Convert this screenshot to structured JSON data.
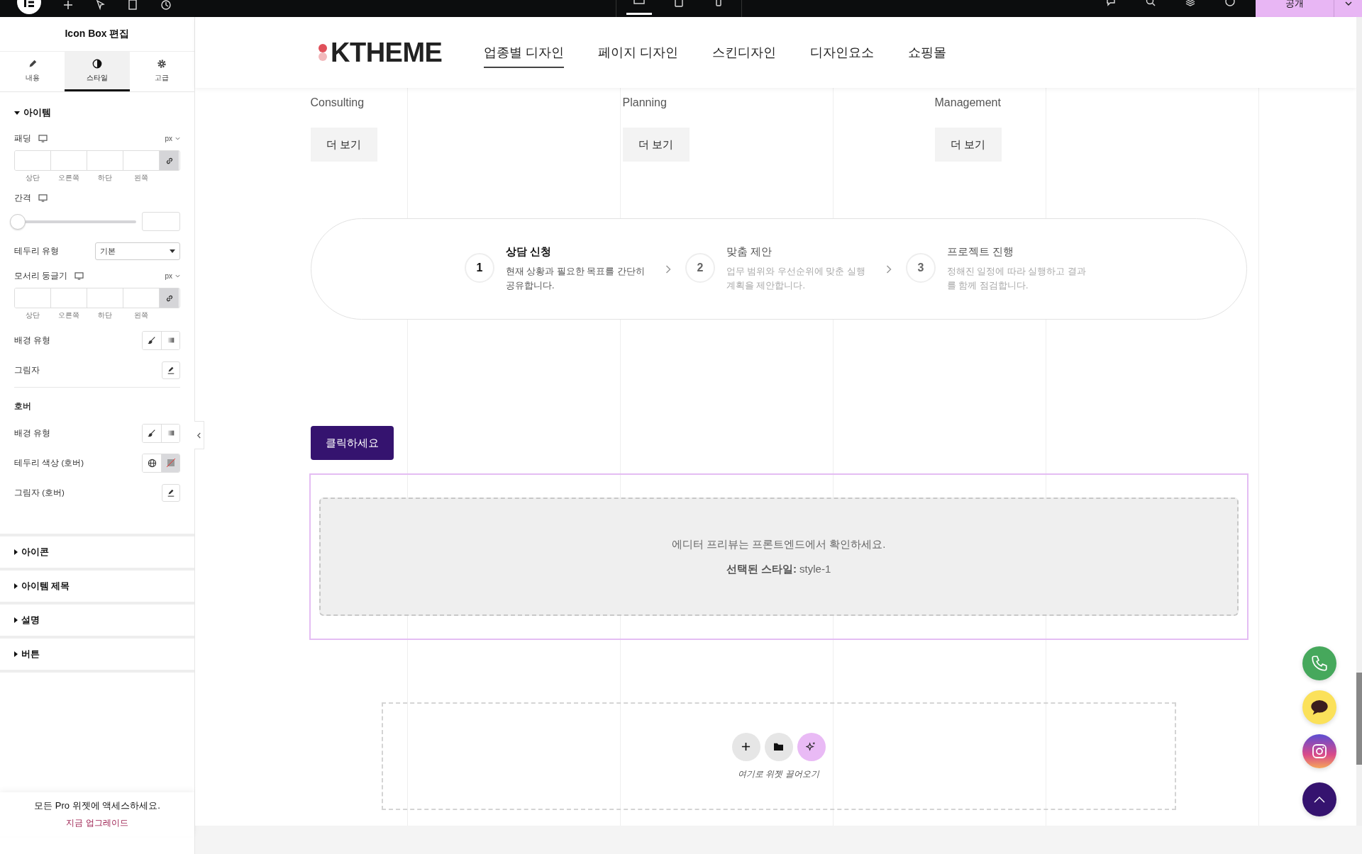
{
  "topbar": {
    "publish_label": "공개",
    "device_tabs": [
      {
        "selected": true
      },
      {
        "selected": false
      },
      {
        "selected": false
      }
    ]
  },
  "panel": {
    "title": "Icon Box 편집",
    "tabs": [
      {
        "label": "내용",
        "kind": "pencil",
        "selected": false
      },
      {
        "label": "스타일",
        "kind": "contrast",
        "selected": true
      },
      {
        "label": "고급",
        "kind": "gear",
        "selected": false
      }
    ],
    "section": {
      "title": "아이템",
      "expanded": true
    },
    "controls": [
      {
        "kind": "dimensions",
        "label": "패딩",
        "unit": "px",
        "sides": [
          "상단",
          "오른쪽",
          "하단",
          "왼쪽"
        ]
      },
      {
        "kind": "slider",
        "label": "간격",
        "level": 0
      },
      {
        "kind": "select",
        "label": "테두리 유형",
        "value": "기본"
      },
      {
        "kind": "dimensions",
        "label": "모서리 둥글기",
        "unit": "px",
        "sides": [
          "상단",
          "오른쪽",
          "하단",
          "왼쪽"
        ]
      },
      {
        "kind": "background",
        "label": "배경 유형"
      },
      {
        "kind": "edit",
        "label": "그림자"
      },
      {
        "kind": "heading",
        "label": "호버"
      },
      {
        "kind": "background",
        "label": "배경 유형"
      },
      {
        "kind": "color",
        "label": "테두리 색상 (호버)"
      },
      {
        "kind": "edit",
        "label": "그림자 (호버)"
      }
    ],
    "sections": [
      {
        "title": "아이콘",
        "expanded": false
      },
      {
        "title": "아이템 제목",
        "expanded": false
      },
      {
        "title": "설명",
        "expanded": false
      },
      {
        "title": "버튼",
        "expanded": false
      }
    ],
    "promo": {
      "text": "모든 Pro 위젯에 액세스하세요.",
      "link": "지금 업그레이드"
    }
  },
  "site": {
    "logo": "KTHEME",
    "nav": [
      {
        "label": "업종별 디자인",
        "selected": true
      },
      {
        "label": "페이지 디자인",
        "selected": false
      },
      {
        "label": "스킨디자인",
        "selected": false
      },
      {
        "label": "디자인요소",
        "selected": false
      },
      {
        "label": "쇼핑몰",
        "selected": false
      }
    ],
    "services": [
      {
        "title": "Consulting",
        "button": "더 보기"
      },
      {
        "title": "Planning",
        "button": "더 보기"
      },
      {
        "title": "Management",
        "button": "더 보기"
      }
    ],
    "steps": [
      {
        "number": "1",
        "title": "상담 신청",
        "description": "현재 상황과 필요한 목표를 간단히 공유합니다.",
        "selected": true
      },
      {
        "number": "2",
        "title": "맞춤 제안",
        "description": "업무 범위와 우선순위에 맞춘 실행 계획을 제안합니다.",
        "selected": false
      },
      {
        "number": "3",
        "title": "프로젝트 진행",
        "description": "정해진 일정에 따라 실행하고 결과를 함께 점검합니다.",
        "selected": false
      }
    ],
    "cta": "클릭하세요",
    "preview": {
      "message": "에디터 프리뷰는 프론트엔드에서 확인하세요.",
      "style_line": "**선택된 스타일:** style-1"
    },
    "drop_zone": {
      "hint": "여기로 위젯 끌어오기"
    }
  }
}
